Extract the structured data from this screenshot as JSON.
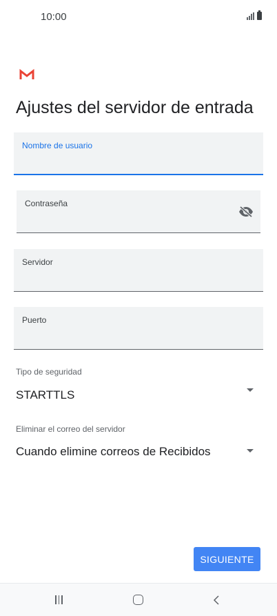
{
  "status_bar": {
    "time": "10:00"
  },
  "page": {
    "title": "Ajustes del servidor de entrada"
  },
  "fields": {
    "username": {
      "label": "Nombre de usuario",
      "value": ""
    },
    "password": {
      "label": "Contraseña",
      "value": "",
      "icon": "eye-off-icon"
    },
    "server": {
      "label": "Servidor",
      "value": ""
    },
    "port": {
      "label": "Puerto",
      "value": ""
    }
  },
  "security": {
    "label": "Tipo de seguridad",
    "value": "STARTTLS"
  },
  "delete_mail": {
    "label": "Eliminar el correo del servidor",
    "value": "Cuando elimine correos de Recibidos"
  },
  "actions": {
    "next_label": "SIGUIENTE"
  },
  "colors": {
    "accent": "#1a73e8",
    "button": "#4285f4",
    "gmail_red": "#ea4335"
  }
}
